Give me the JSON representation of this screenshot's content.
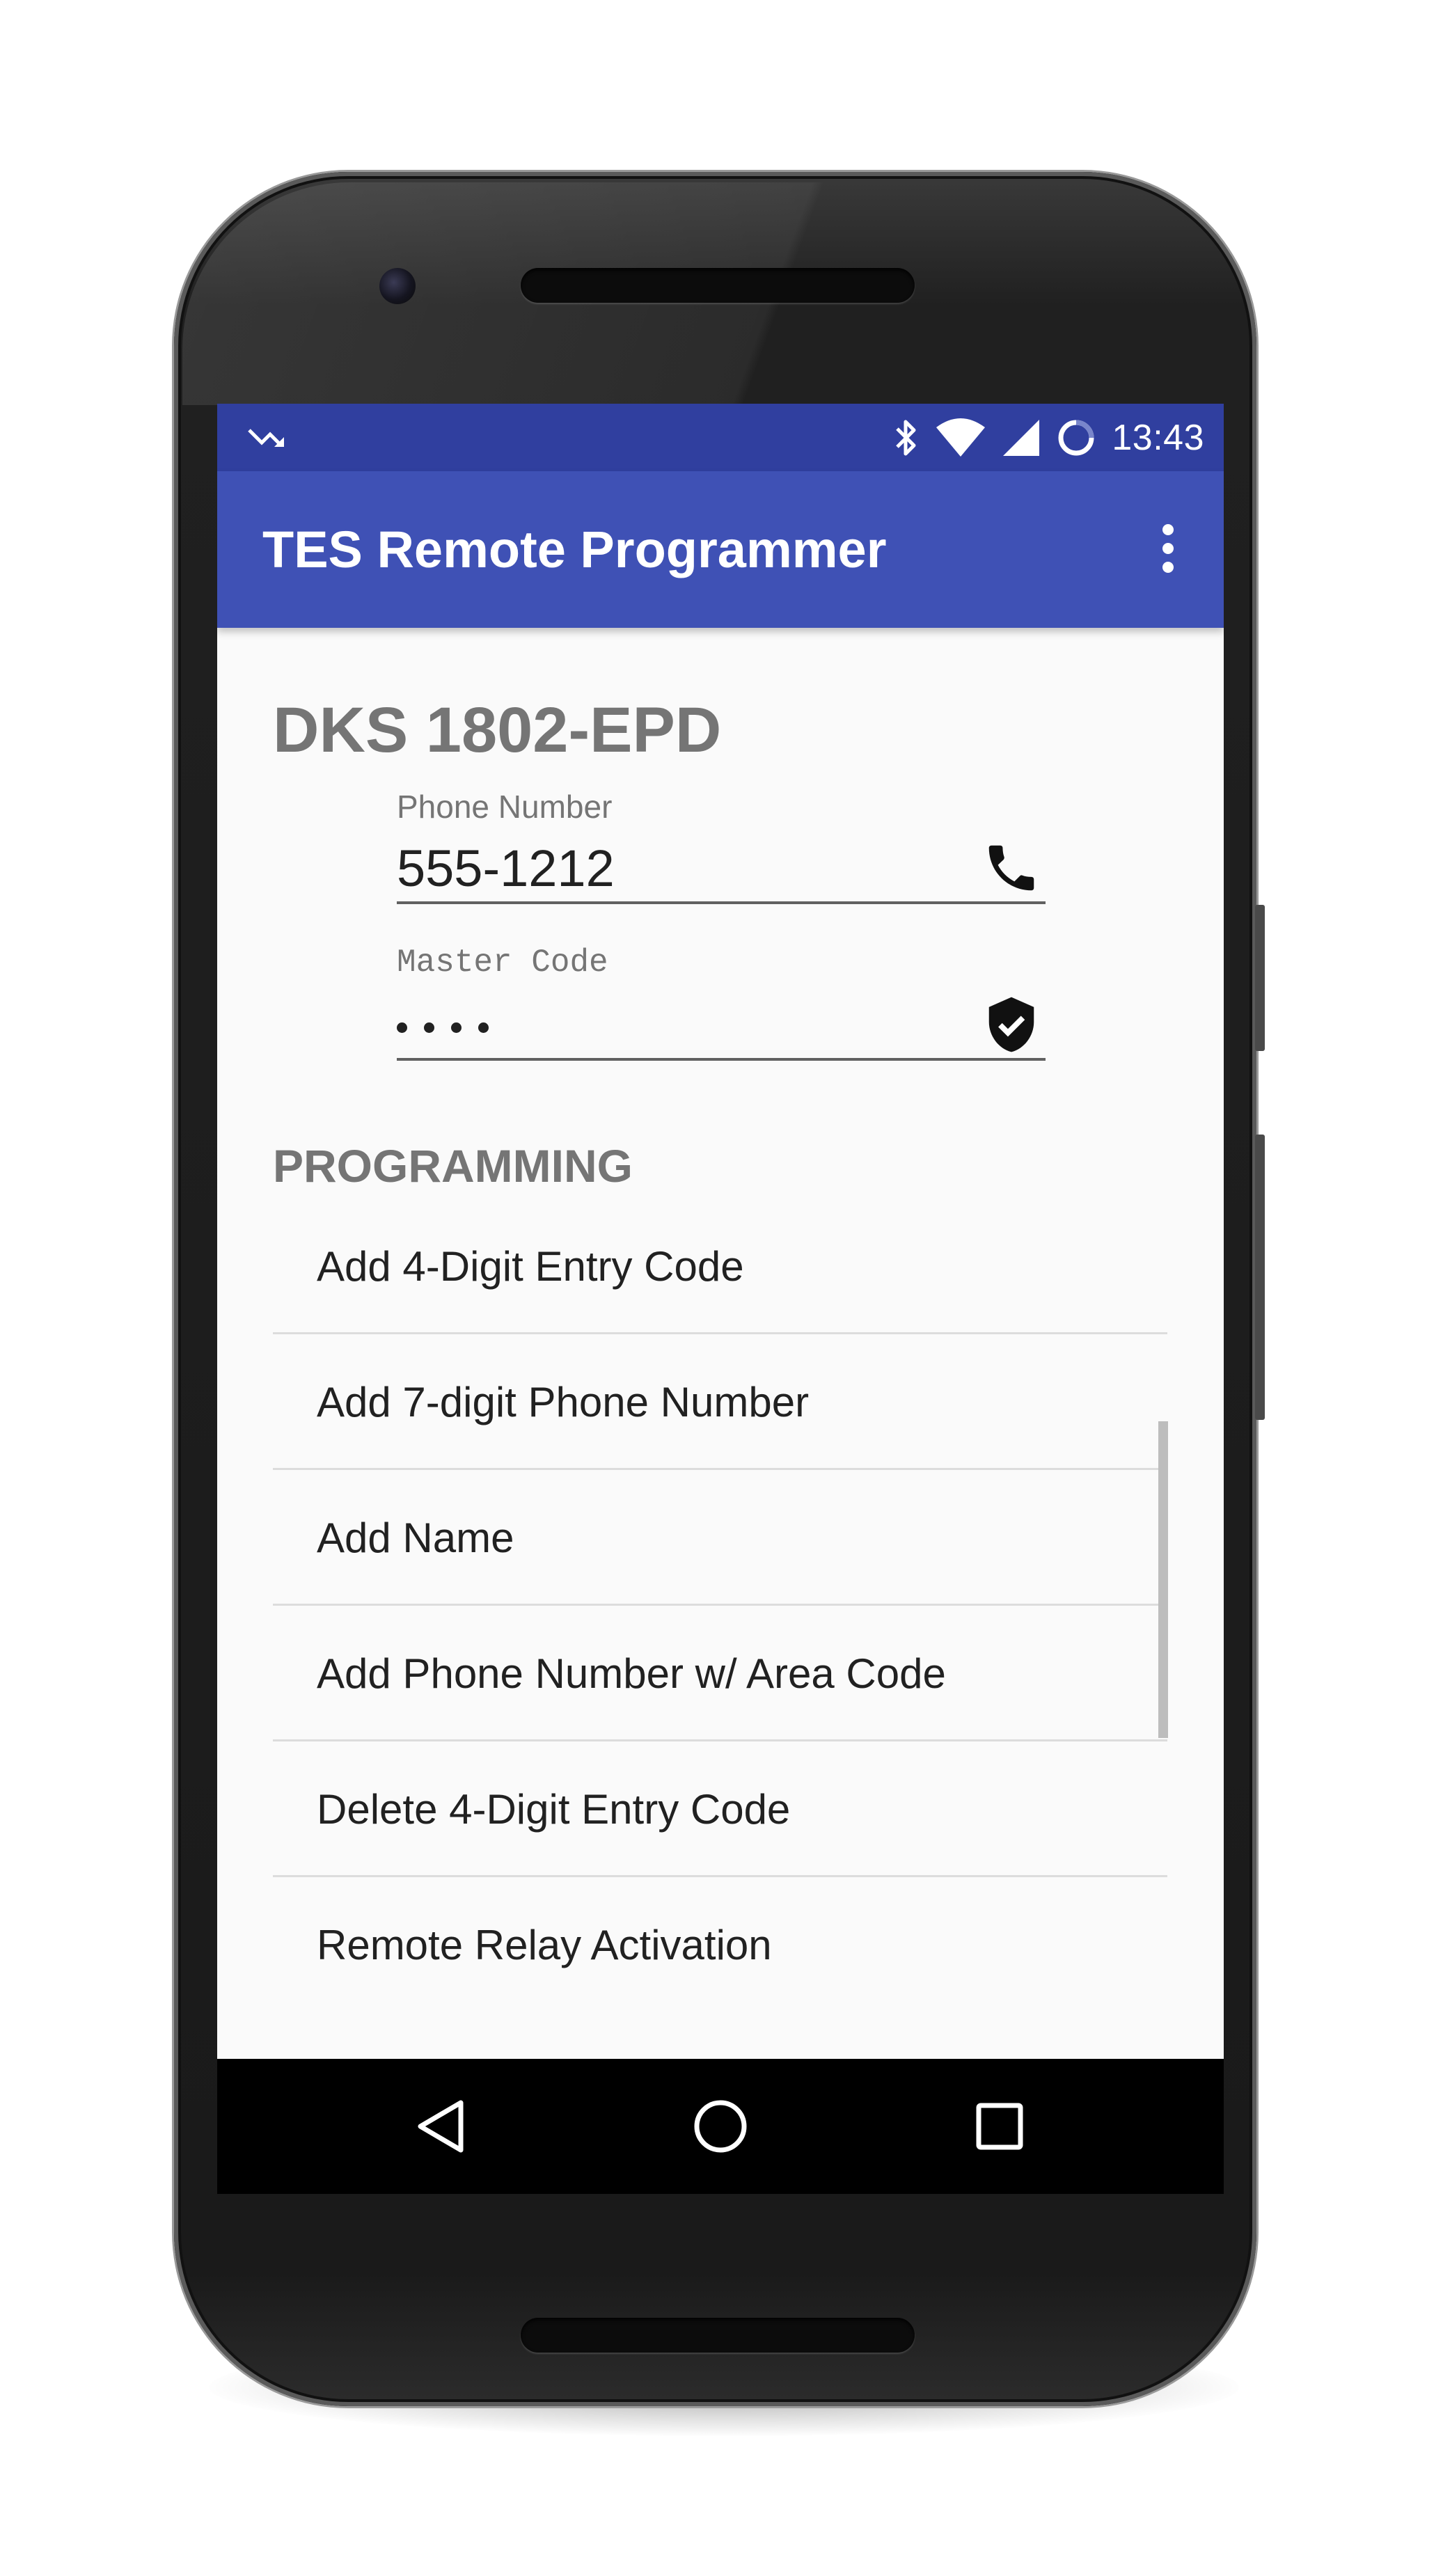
{
  "status_bar": {
    "time": "13:43",
    "icons": [
      "missed-call-icon",
      "bluetooth-icon",
      "wifi-icon",
      "cell-signal-icon",
      "battery-charging-icon"
    ]
  },
  "app_bar": {
    "title": "TES Remote Programmer",
    "overflow_icon": "more-vert-icon"
  },
  "device": {
    "title": "DKS 1802-EPD"
  },
  "phone_field": {
    "label": "Phone Number",
    "value": "555-1212",
    "icon": "phone-icon"
  },
  "master_code_field": {
    "label": "Master Code",
    "masked_length": 4,
    "icon": "verified-shield-icon"
  },
  "programming": {
    "header": "PROGRAMMING",
    "items": [
      {
        "label": "Add 4-Digit Entry Code"
      },
      {
        "label": "Add 7-digit Phone Number"
      },
      {
        "label": "Add Name"
      },
      {
        "label": "Add Phone Number w/ Area Code"
      },
      {
        "label": "Delete 4-Digit Entry Code"
      },
      {
        "label": "Remote Relay Activation"
      }
    ]
  },
  "nav_bar": {
    "back_icon": "back-triangle-icon",
    "home_icon": "home-circle-icon",
    "recents_icon": "recents-square-icon"
  },
  "colors": {
    "primary": "#3f51b5",
    "primary_dark": "#303f9f",
    "background": "#fafafa",
    "title_gray": "#757575",
    "text": "#212121"
  }
}
